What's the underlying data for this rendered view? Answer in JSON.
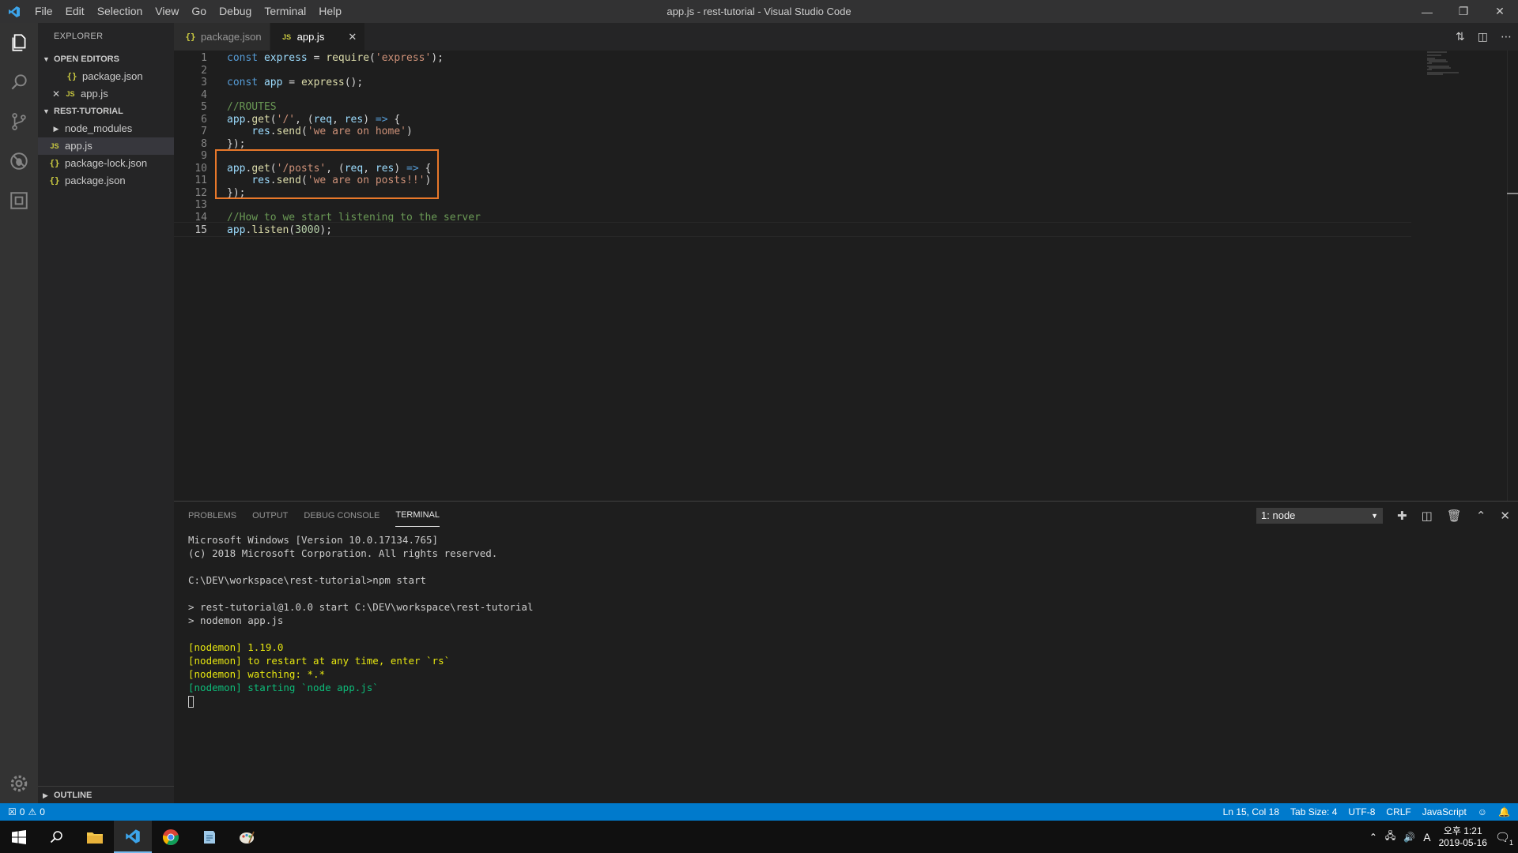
{
  "window": {
    "title": "app.js - rest-tutorial - Visual Studio Code",
    "menu": [
      "File",
      "Edit",
      "Selection",
      "View",
      "Go",
      "Debug",
      "Terminal",
      "Help"
    ]
  },
  "sidebar": {
    "title": "EXPLORER",
    "open_editors_label": "OPEN EDITORS",
    "open_editors": [
      {
        "icon": "{}",
        "name": "package.json"
      },
      {
        "icon": "JS",
        "name": "app.js"
      }
    ],
    "project_label": "REST-TUTORIAL",
    "files": [
      {
        "icon": "folder",
        "name": "node_modules"
      },
      {
        "icon": "JS",
        "name": "app.js"
      },
      {
        "icon": "{}",
        "name": "package-lock.json"
      },
      {
        "icon": "{}",
        "name": "package.json"
      }
    ],
    "outline_label": "OUTLINE"
  },
  "tabs": [
    {
      "icon": "{}",
      "name": "package.json"
    },
    {
      "icon": "JS",
      "name": "app.js"
    }
  ],
  "editor": {
    "current_line": 15,
    "lines": [
      "1",
      "2",
      "3",
      "4",
      "5",
      "6",
      "7",
      "8",
      "9",
      "10",
      "11",
      "12",
      "13",
      "14",
      "15"
    ]
  },
  "panel": {
    "tabs": [
      "PROBLEMS",
      "OUTPUT",
      "DEBUG CONSOLE",
      "TERMINAL"
    ],
    "terminal_select": "1: node",
    "terminal_lines": [
      "Microsoft Windows [Version 10.0.17134.765]",
      "(c) 2018 Microsoft Corporation. All rights reserved.",
      "",
      "C:\\DEV\\workspace\\rest-tutorial>npm start",
      "",
      "> rest-tutorial@1.0.0 start C:\\DEV\\workspace\\rest-tutorial",
      "> nodemon app.js",
      "",
      "[nodemon] 1.19.0",
      "[nodemon] to restart at any time, enter `rs`",
      "[nodemon] watching: *.*",
      "[nodemon] starting `node app.js`"
    ]
  },
  "status": {
    "errors": "0",
    "warnings": "0",
    "position": "Ln 15, Col 18",
    "tab_size": "Tab Size: 4",
    "encoding": "UTF-8",
    "eol": "CRLF",
    "language": "JavaScript"
  },
  "taskbar": {
    "ime": "A",
    "time": "오후 1:21",
    "date": "2019-05-16",
    "notif_count": "1"
  },
  "colors": {
    "accent": "#007acc",
    "highlight_box": "#e8782a"
  }
}
